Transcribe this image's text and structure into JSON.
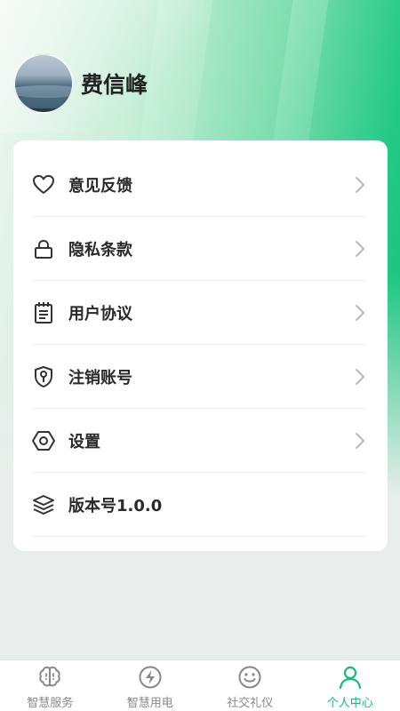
{
  "profile": {
    "name": "费信峰"
  },
  "menu": [
    {
      "label": "意见反馈",
      "icon": "heart-icon",
      "has_arrow": true
    },
    {
      "label": "隐私条款",
      "icon": "lock-icon",
      "has_arrow": true
    },
    {
      "label": "用户协议",
      "icon": "notepad-icon",
      "has_arrow": true
    },
    {
      "label": "注销账号",
      "icon": "shield-key-icon",
      "has_arrow": true
    },
    {
      "label": "设置",
      "icon": "hexagon-nut-icon",
      "has_arrow": true
    },
    {
      "label": "版本号1.0.0",
      "icon": "layers-icon",
      "has_arrow": false
    }
  ],
  "tabs": [
    {
      "label": "智慧服务",
      "icon": "brain-icon",
      "active": false
    },
    {
      "label": "智慧用电",
      "icon": "lightning-icon",
      "active": false
    },
    {
      "label": "社交礼仪",
      "icon": "smiley-icon",
      "active": false
    },
    {
      "label": "个人中心",
      "icon": "person-icon",
      "active": true
    }
  ],
  "colors": {
    "accent": "#17b87d",
    "icon_gray": "#888888",
    "icon_dark": "#333333"
  }
}
